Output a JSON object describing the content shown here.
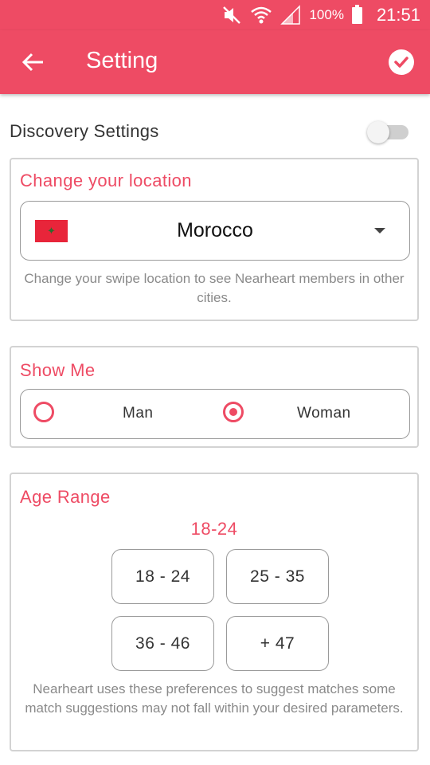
{
  "status_bar": {
    "battery_percent": "100%",
    "time": "21:51"
  },
  "app_bar": {
    "title": "Setting",
    "back_icon": "arrow-left-icon",
    "confirm_icon": "check-circle-icon"
  },
  "discovery": {
    "label": "Discovery Settings",
    "enabled": false
  },
  "location": {
    "title": "Change your location",
    "selected": "Morocco",
    "flag_icon": "morocco-flag-icon",
    "help": "Change your swipe location to see Nearheart members in other cities."
  },
  "show_me": {
    "title": "Show Me",
    "options": [
      "Man",
      "Woman"
    ],
    "selected": "Woman"
  },
  "age_range": {
    "title": "Age Range",
    "current": "18-24",
    "options": [
      "18 - 24",
      "25 - 35",
      "36 - 46",
      "+ 47"
    ],
    "help": "Nearheart uses these preferences to suggest matches some match suggestions may not fall within your desired parameters."
  },
  "colors": {
    "accent": "#ee4b64",
    "border": "#d3d3d3",
    "help_text": "#8a8a8a"
  }
}
